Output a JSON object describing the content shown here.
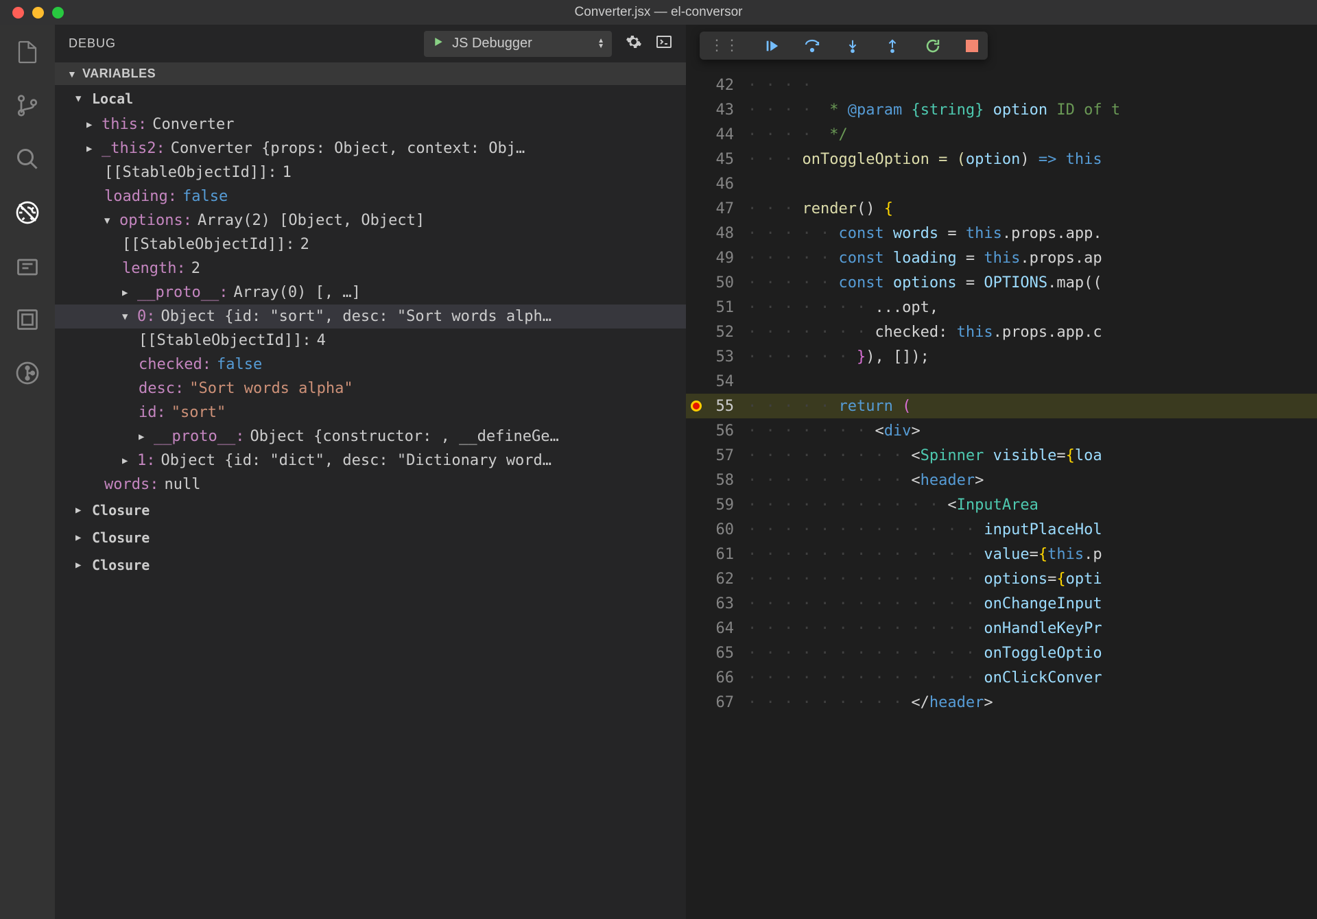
{
  "title": "Converter.jsx — el-conversor",
  "sidebar_header": {
    "label": "DEBUG",
    "config_name": "JS Debugger"
  },
  "sections": {
    "variables": "VARIABLES"
  },
  "scope": {
    "local": "Local",
    "closure": "Closure"
  },
  "vars": {
    "this_k": "this:",
    "this_v": "Converter",
    "this2_k": "_this2:",
    "this2_v": "Converter {props: Object, context: Obj…",
    "stable_k": "[[StableObjectId]]:",
    "stable_v1": "1",
    "loading_k": "loading:",
    "loading_v": "false",
    "options_k": "options:",
    "options_v": "Array(2) [Object, Object]",
    "stable_v2": "2",
    "length_k": "length:",
    "length_v": "2",
    "proto_k": "__proto__:",
    "proto_v_arr": "Array(0) [, …]",
    "idx0_k": "0:",
    "idx0_v": "Object {id: \"sort\", desc: \"Sort words alph…",
    "stable_v4": "4",
    "checked_k": "checked:",
    "checked_v": "false",
    "desc_k": "desc:",
    "desc_v": "\"Sort words alpha\"",
    "id_k": "id:",
    "id_v": "\"sort\"",
    "proto_v_obj": "Object {constructor: , __defineGe…",
    "idx1_k": "1:",
    "idx1_v": "Object {id: \"dict\", desc: \"Dictionary word…",
    "words_k": "words:",
    "words_v": "null"
  },
  "line_numbers": [
    "42",
    "43",
    "44",
    "45",
    "46",
    "47",
    "48",
    "49",
    "50",
    "51",
    "52",
    "53",
    "54",
    "55",
    "56",
    "57",
    "58",
    "59",
    "60",
    "61",
    "62",
    "63",
    "64",
    "65",
    "66",
    "67"
  ],
  "code": {
    "l43a": " * ",
    "l43b": "@param",
    "l43c": " {string}",
    "l43d": " option",
    "l43e": " ID of t",
    "l44": " */",
    "l45a": "onToggleOption = (",
    "l45b": "option",
    "l45c": ") ",
    "l45d": "=>",
    "l45e": " this",
    "l47a": "render",
    "l47b": "() ",
    "l47c": "{",
    "l48a": "const",
    "l48b": " words",
    "l48c": " = ",
    "l48d": "this",
    "l48e": ".props.app.",
    "l49a": "const",
    "l49b": " loading",
    "l49c": " = ",
    "l49d": "this",
    "l49e": ".props.ap",
    "l50a": "const",
    "l50b": " options",
    "l50c": " = ",
    "l50d": "OPTIONS",
    "l50e": ".map((",
    "l51": "...opt,",
    "l52a": "checked: ",
    "l52b": "this",
    "l52c": ".props.app.c",
    "l53a": "}",
    "l53b": "), []);",
    "l55a": "return",
    "l55b": " (",
    "l56a": "<",
    "l56b": "div",
    "l56c": ">",
    "l57a": "<",
    "l57b": "Spinner",
    "l57c": " visible",
    "l57d": "=",
    "l57e": "{",
    "l57f": "loa",
    "l58a": "<",
    "l58b": "header",
    "l58c": ">",
    "l59a": "<",
    "l59b": "InputArea",
    "l60a": "inputPlaceHol",
    "l61a": "value",
    "l61b": "=",
    "l61c": "{",
    "l61d": "this",
    "l61e": ".p",
    "l62a": "options",
    "l62b": "=",
    "l62c": "{",
    "l62d": "opti",
    "l63a": "onChangeInput",
    "l64a": "onHandleKeyPr",
    "l65a": "onToggleOptio",
    "l66a": "onClickConver",
    "l67a": "</",
    "l67b": "header",
    "l67c": ">"
  }
}
